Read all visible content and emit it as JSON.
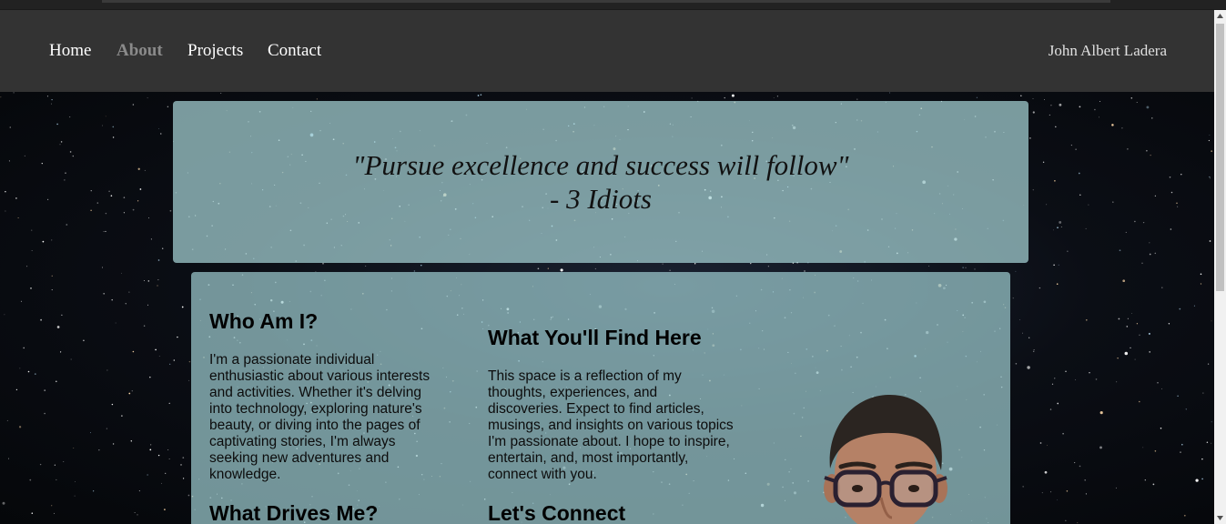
{
  "nav": {
    "items": [
      {
        "label": "Home"
      },
      {
        "label": "About",
        "active": true
      },
      {
        "label": "Projects"
      },
      {
        "label": "Contact"
      }
    ],
    "brand": "John Albert Ladera"
  },
  "quote": {
    "line1": "\"Pursue excellence and success will follow\"",
    "line2": "- 3 Idiots"
  },
  "about": {
    "who": {
      "heading": "Who Am I?",
      "text": "I'm a passionate individual enthusiastic about various interests and activities. Whether it's delving into technology, exploring nature's beauty, or diving into the pages of captivating stories, I'm always seeking new adventures and knowledge."
    },
    "find": {
      "heading": "What You'll Find Here",
      "text": "This space is a reflection of my thoughts, experiences, and discoveries. Expect to find articles, musings, and insights on various topics I'm passionate about. I hope to inspire, entertain, and, most importantly, connect with you."
    },
    "drives": {
      "heading": "What Drives Me?"
    },
    "connect": {
      "heading": "Let's Connect"
    }
  },
  "colors": {
    "navbar": "#333333",
    "nav_active": "#8a8a8a",
    "panel": "#a6d2d6"
  },
  "icons": {
    "portrait": "profile-photo",
    "scroll_up": "chevron-up-icon",
    "scroll_down": "chevron-down-icon"
  }
}
